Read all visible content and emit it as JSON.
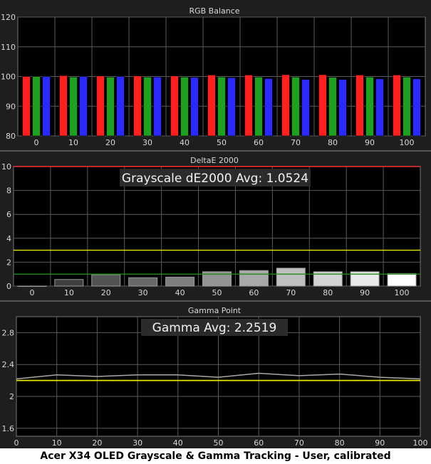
{
  "caption": "Acer X34 OLED Grayscale & Gamma Tracking - User, calibrated",
  "colors": {
    "panel_bg": "#1e1e1e",
    "plot_bg": "#000000",
    "grid": "#5a5a5a",
    "text": "#d8d8d8",
    "red": "#ff2020",
    "green": "#20a020",
    "blue": "#2a2aff",
    "yellow": "#e8e800",
    "target_green": "#1c8c1c",
    "delta_max": "#ff3030"
  },
  "chart_data": [
    {
      "type": "bar",
      "title": "RGB Balance",
      "categories": [
        "0",
        "10",
        "20",
        "30",
        "40",
        "50",
        "60",
        "70",
        "80",
        "90",
        "100"
      ],
      "series": [
        {
          "name": "Red",
          "color": "#ff2020",
          "values": [
            100,
            100.3,
            100.2,
            100.2,
            100.2,
            100.5,
            100.5,
            100.6,
            100.6,
            100.5,
            100.5
          ]
        },
        {
          "name": "Green",
          "color": "#20a020",
          "values": [
            100,
            99.8,
            99.8,
            99.8,
            99.8,
            99.8,
            99.8,
            99.8,
            99.7,
            99.8,
            99.8
          ]
        },
        {
          "name": "Blue",
          "color": "#2a2aff",
          "values": [
            100,
            100,
            100,
            99.8,
            99.7,
            99.6,
            99.3,
            99.0,
            99.0,
            99.2,
            99.2
          ]
        }
      ],
      "ylim": [
        80,
        120
      ],
      "yticks": [
        80,
        90,
        100,
        110,
        120
      ],
      "grid": true
    },
    {
      "type": "bar",
      "title": "DeltaE 2000",
      "annotation": "Grayscale dE2000 Avg: 1.0524",
      "categories": [
        "0",
        "10",
        "20",
        "30",
        "40",
        "50",
        "60",
        "70",
        "80",
        "90",
        "100"
      ],
      "values": [
        0.0,
        0.55,
        0.95,
        0.7,
        0.75,
        1.2,
        1.3,
        1.5,
        1.2,
        1.2,
        1.05
      ],
      "ylim": [
        0,
        10
      ],
      "yticks": [
        0,
        2,
        4,
        6,
        8,
        10
      ],
      "reference_lines": [
        {
          "value": 3,
          "color": "#e8e800"
        },
        {
          "value": 1,
          "color": "#1c8c1c"
        },
        {
          "value": 10,
          "color": "#ff3030"
        }
      ],
      "grid": true
    },
    {
      "type": "line",
      "title": "Gamma Point",
      "annotation": "Gamma Avg: 2.2519",
      "x": [
        0,
        10,
        20,
        30,
        40,
        50,
        60,
        70,
        80,
        90,
        100
      ],
      "series": [
        {
          "name": "Measured",
          "color": "#a8a8a8",
          "values": [
            2.22,
            2.27,
            2.25,
            2.27,
            2.27,
            2.24,
            2.29,
            2.26,
            2.28,
            2.24,
            2.22
          ]
        },
        {
          "name": "Target",
          "color": "#e8e800",
          "values": [
            2.2,
            2.2,
            2.2,
            2.2,
            2.2,
            2.2,
            2.2,
            2.2,
            2.2,
            2.2,
            2.2
          ]
        }
      ],
      "xlim": [
        0,
        100
      ],
      "ylim": [
        1.5,
        3.0
      ],
      "yticks": [
        "1.6",
        "2",
        "2.4",
        "2.8"
      ],
      "xticks": [
        0,
        10,
        20,
        30,
        40,
        50,
        60,
        70,
        80,
        90,
        100
      ],
      "grid": true
    }
  ]
}
